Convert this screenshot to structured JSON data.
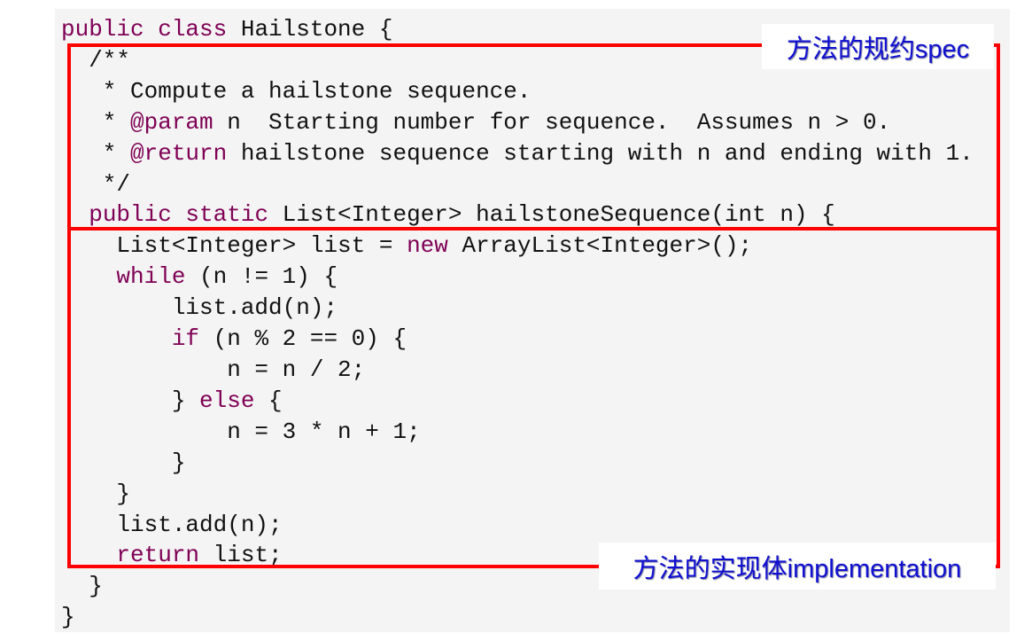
{
  "code_lines": [
    [
      [
        "public class",
        "kw"
      ],
      [
        " Hailstone {",
        ""
      ]
    ],
    [
      [
        "  /**",
        ""
      ]
    ],
    [
      [
        "   * Compute a hailstone sequence.",
        ""
      ]
    ],
    [
      [
        "   * ",
        ""
      ],
      [
        "@param",
        "tag"
      ],
      [
        " n  Starting number for sequence.  Assumes n > 0.",
        ""
      ]
    ],
    [
      [
        "   * ",
        ""
      ],
      [
        "@return",
        "tag"
      ],
      [
        " hailstone sequence starting with n and ending with 1.",
        ""
      ]
    ],
    [
      [
        "   */",
        ""
      ]
    ],
    [
      [
        "  ",
        ""
      ],
      [
        "public static",
        "kw"
      ],
      [
        " List<Integer> hailstoneSequence(int n) {",
        ""
      ]
    ],
    [
      [
        "    List<Integer> list = ",
        ""
      ],
      [
        "new",
        "kw"
      ],
      [
        " ArrayList<Integer>();",
        ""
      ]
    ],
    [
      [
        "    ",
        ""
      ],
      [
        "while",
        "kw"
      ],
      [
        " (n != 1) {",
        ""
      ]
    ],
    [
      [
        "        list.add(n);",
        ""
      ]
    ],
    [
      [
        "        ",
        ""
      ],
      [
        "if",
        "kw"
      ],
      [
        " (n % 2 == 0) {",
        ""
      ]
    ],
    [
      [
        "            n = n / 2;",
        ""
      ]
    ],
    [
      [
        "        } ",
        ""
      ],
      [
        "else",
        "kw"
      ],
      [
        " {",
        ""
      ]
    ],
    [
      [
        "            n = 3 * n + 1;",
        ""
      ]
    ],
    [
      [
        "        }",
        ""
      ]
    ],
    [
      [
        "    }",
        ""
      ]
    ],
    [
      [
        "    list.add(n);",
        ""
      ]
    ],
    [
      [
        "    ",
        ""
      ],
      [
        "return",
        "kw"
      ],
      [
        " list;",
        ""
      ]
    ],
    [
      [
        "  }",
        ""
      ]
    ],
    [
      [
        "}",
        ""
      ]
    ]
  ],
  "annotations": {
    "spec_label": "方法的规约spec",
    "impl_label": "方法的实现体implementation"
  },
  "colors": {
    "keyword": "#7f0055",
    "box": "#ff0000",
    "label_text": "#1010d0"
  }
}
